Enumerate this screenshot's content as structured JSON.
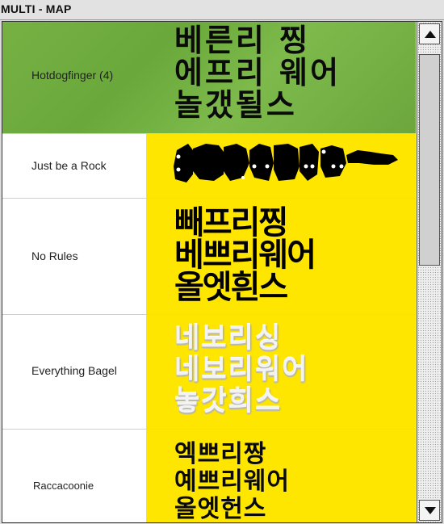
{
  "window": {
    "title": "MULTI - MAP"
  },
  "fonts": [
    {
      "label": "Hotdogfinger (4)",
      "preview_lines": [
        "베른리 찡",
        "에프리 웨어",
        "놀갰될스"
      ]
    },
    {
      "label": "Just be a Rock",
      "preview_lines": []
    },
    {
      "label": "No Rules",
      "preview_lines": [
        "빼프리찡",
        "베쁘리웨어",
        "올엣흰스"
      ]
    },
    {
      "label": "Everything Bagel",
      "preview_lines": [
        "네보리싱",
        "네보리워어",
        "놓갓희스"
      ]
    },
    {
      "label": "Raccacoonie",
      "preview_lines": [
        "엑쁘리짱",
        "예쁘리웨어",
        "올엣헌스"
      ]
    }
  ],
  "scrollbar": {
    "up_icon": "triangle-up-icon",
    "down_icon": "triangle-down-icon",
    "position": 0.0
  },
  "colors": {
    "preview_bg": "#ffe600",
    "selected_bg": "#6ea83e",
    "glyph": "#000000"
  }
}
